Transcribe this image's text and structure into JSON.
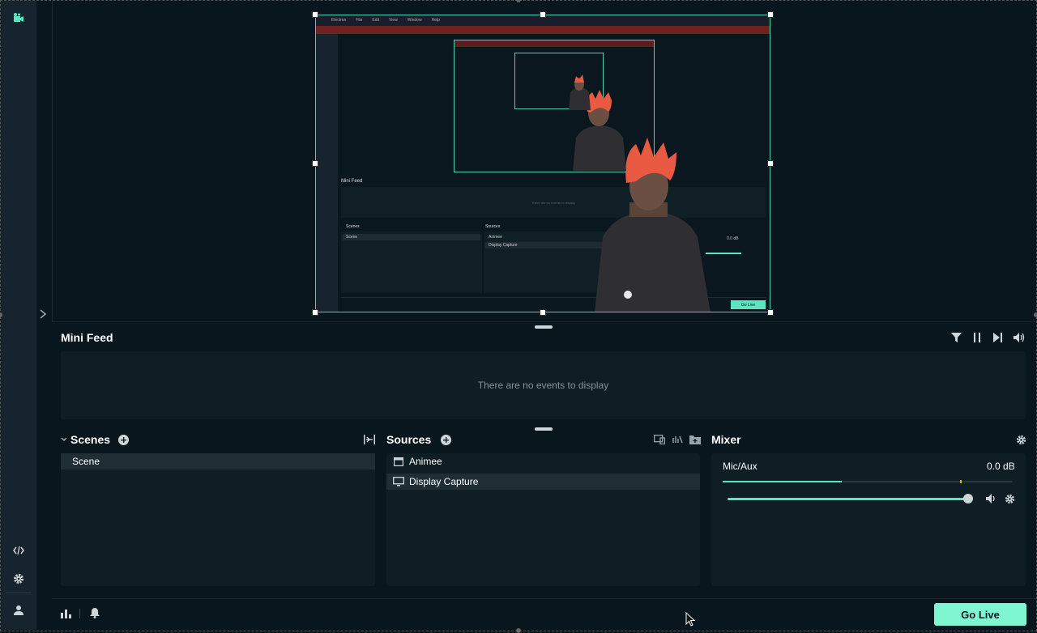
{
  "minifeed": {
    "title": "Mini Feed",
    "empty_message": "There are no events to display"
  },
  "scenes": {
    "title": "Scenes",
    "items": [
      "Scene"
    ]
  },
  "sources": {
    "title": "Sources",
    "items": [
      "Animee",
      "Display Capture"
    ]
  },
  "mixer": {
    "title": "Mixer",
    "channel": "Mic/Aux",
    "level": "0.0 dB",
    "meter_fraction": 0.41,
    "volume_fraction": 1.0
  },
  "footer": {
    "golive_label": "Go Live"
  },
  "preview": {
    "menubar_items": [
      "Electron",
      "File",
      "Edit",
      "View",
      "Window",
      "Help"
    ],
    "minifeed_title": "Mini Feed",
    "empty_message": "There are no events to display",
    "scenes_title": "Scenes",
    "scene_item": "Scene",
    "sources_title": "Sources",
    "source_items": [
      "Animee",
      "Display Capture"
    ],
    "level": "0.0 dB",
    "golive_label": "Go Live"
  },
  "colors": {
    "accent": "#5de4c0",
    "golive": "#80f5d2",
    "background": "#09161d",
    "panel": "#0f1d25",
    "nav": "#17242d",
    "selection": "#4fd1b5"
  }
}
